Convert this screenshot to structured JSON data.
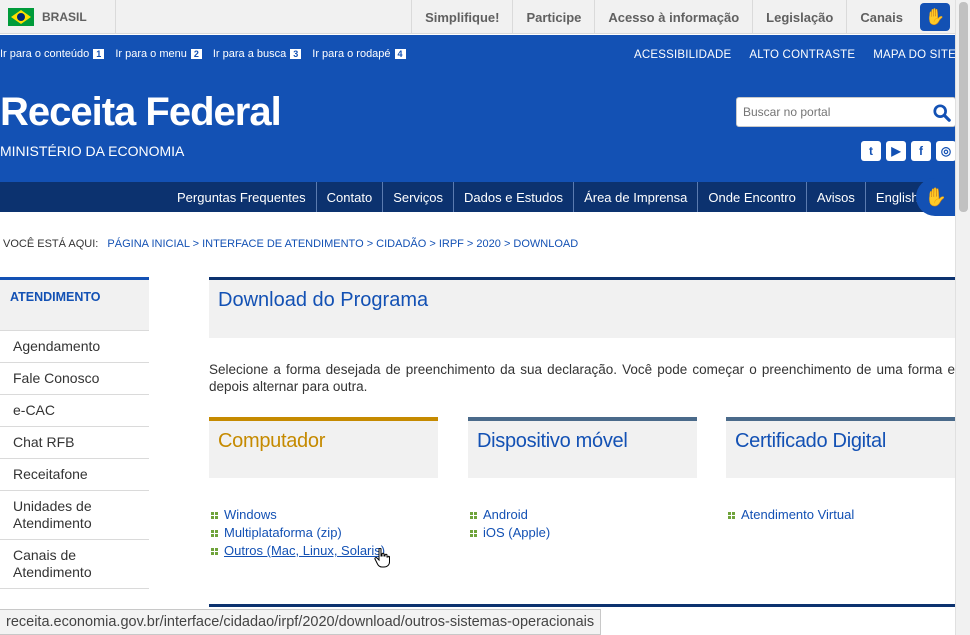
{
  "govbar": {
    "country": "BRASIL",
    "links": [
      "Simplifique!",
      "Participe",
      "Acesso à informação",
      "Legislação",
      "Canais"
    ]
  },
  "header": {
    "skip_links": [
      {
        "label": "Ir para o conteúdo",
        "key": "1"
      },
      {
        "label": "Ir para o menu",
        "key": "2"
      },
      {
        "label": "Ir para a busca",
        "key": "3"
      },
      {
        "label": "Ir para o rodapé",
        "key": "4"
      }
    ],
    "top_links": [
      "ACESSIBILIDADE",
      "ALTO CONTRASTE",
      "MAPA DO SITE"
    ],
    "title": "Receita Federal",
    "subtitle": "MINISTÉRIO DA ECONOMIA",
    "search_placeholder": "Buscar no portal",
    "social_icons": [
      "twitter-icon",
      "youtube-icon",
      "facebook-icon",
      "instagram-icon"
    ]
  },
  "nav": {
    "items": [
      "Perguntas Frequentes",
      "Contato",
      "Serviços",
      "Dados e Estudos",
      "Área de Imprensa",
      "Onde Encontro",
      "Avisos",
      "English",
      "Es"
    ]
  },
  "breadcrumb": {
    "label": "VOCÊ ESTÁ AQUI:",
    "trail": "PÁGINA INICIAL > INTERFACE DE ATENDIMENTO > CIDADÃO > IRPF > 2020 > DOWNLOAD"
  },
  "sidebar": {
    "heading": "ATENDIMENTO",
    "items": [
      "Agendamento",
      "Fale Conosco",
      "e-CAC",
      "Chat RFB",
      "Receitafone",
      "Unidades de Atendimento",
      "Canais de Atendimento"
    ]
  },
  "main": {
    "title": "Download do Programa",
    "intro": "Selecione a forma desejada de preenchimento da sua declaração. Você pode começar o preenchimento de uma forma e depois alternar para outra.",
    "cards": [
      {
        "title": "Computador",
        "color": "#c58a00",
        "links": [
          "Windows",
          "Multiplataforma (zip)",
          "Outros (Mac, Linux, Solaris)"
        ]
      },
      {
        "title": "Dispositivo móvel",
        "color": "#1351b4",
        "links": [
          "Android",
          "iOS (Apple)"
        ]
      },
      {
        "title": "Certificado Digital",
        "color": "#1351b4",
        "links": [
          "Atendimento Virtual"
        ]
      }
    ]
  },
  "statusbar": {
    "url": "receita.economia.gov.br/interface/cidadao/irpf/2020/download/outros-sistemas-operacionais"
  }
}
